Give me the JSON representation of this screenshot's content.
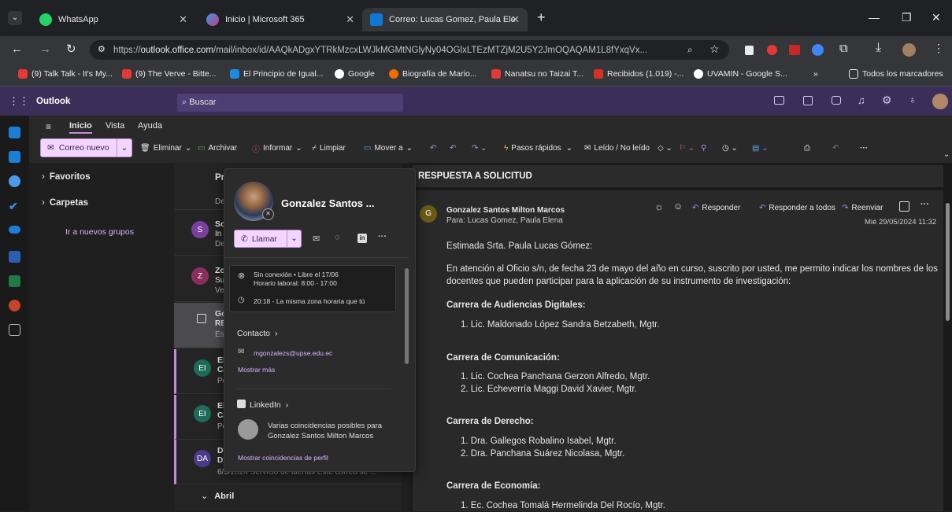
{
  "browser": {
    "tabs": [
      {
        "label": "WhatsApp",
        "active": false
      },
      {
        "label": "Inicio | Microsoft 365",
        "active": false
      },
      {
        "label": "Correo: Lucas Gomez, Paula Ele",
        "active": true
      }
    ],
    "url_prefix": "https://",
    "url_host": "outlook.office.com",
    "url_path": "/mail/inbox/id/AAQkADgxYTRkMzcxLWJkMGMtNGlyNy04OGlxLTEzMTZjM2U5Y2JmOQAQAM1L8fYxqVx...",
    "bookmarks": [
      "(9) Talk Talk - It's My...",
      "(9) The Verve - Bitte...",
      "El Principio de Igual...",
      "Google",
      "Biografía de Mario...",
      "Nanatsu no Taizai T...",
      "Recibidos (1.019) -...",
      "UVAMIN - Google S..."
    ],
    "all_bookmarks": "Todos los marcadores"
  },
  "outlook": {
    "app_name": "Outlook",
    "search_placeholder": "Buscar",
    "ribbon_tabs": [
      "Inicio",
      "Vista",
      "Ayuda"
    ],
    "new_mail": "Correo nuevo",
    "commands": [
      "Eliminar",
      "Archivar",
      "Informar",
      "Limpiar",
      "Mover a",
      "Pasos rápidos",
      "Leído / No leído"
    ],
    "folders": {
      "favorites": "Favoritos",
      "folders": "Carpetas",
      "groups_link": "Ir a nuevos grupos"
    },
    "list_header": "Pr",
    "list_items": [
      {
        "initials": "",
        "line1": "De",
        "line2": "",
        "line3": ""
      },
      {
        "initials": "S",
        "line1": "So",
        "line2": "In",
        "line3": "De"
      },
      {
        "initials": "Z",
        "line1": "Zo",
        "line2": "Su",
        "line3": "Ve"
      },
      {
        "initials": "",
        "line1": "Go",
        "line2": "RE",
        "line3": "Es"
      },
      {
        "initials": "EI",
        "line1": "Els",
        "line2": "Ca",
        "line3": "Po"
      },
      {
        "initials": "EI",
        "line1": "Els",
        "line2": "Ca",
        "line3": "Po"
      },
      {
        "initials": "DA",
        "line1": "Di",
        "line2": "Di",
        "line3": "6/5/2024 Servicio de alertas Este correo se ..."
      }
    ],
    "month_group": "Abril"
  },
  "message": {
    "subject": "RESPUESTA A SOLICITUD",
    "sender_initial": "G",
    "sender": "Gonzalez Santos Milton Marcos",
    "to": "Para: Lucas Gomez, Paula Elena",
    "date": "Mié 29/05/2024 11:32",
    "actions": [
      "Responder",
      "Responder a todos",
      "Reenviar"
    ],
    "greeting": "Estimada Srta. Paula Lucas Gómez:",
    "intro": "En atención al Oficio s/n, de fecha 23 de mayo del año en curso, suscrito por usted, me permito indicar los nombres de los docentes que pueden participar para la aplicación de su instrumento de investigación:",
    "sections": [
      {
        "title": "Carrera de Audiencias Digitales:",
        "items": [
          "1. Lic. Maldonado López Sandra Betzabeth, Mgtr."
        ]
      },
      {
        "title": "Carrera de Comunicación:",
        "items": [
          "1. Lic. Cochea Panchana Gerzon Alfredo, Mgtr.",
          "2. Lic. Echeverría Maggi David Xavier, Mgtr."
        ]
      },
      {
        "title": "Carrera de Derecho:",
        "items": [
          "1. Dra. Gallegos Robalino Isabel, Mgtr.",
          "2. Dra. Panchana Suárez Nicolasa, Mgtr."
        ]
      },
      {
        "title": "Carrera de Economía:",
        "items": [
          "1. Ec. Cochea Tomalá Hermelinda Del Rocío, Mgtr."
        ]
      }
    ]
  },
  "contact_card": {
    "name": "Gonzalez Santos ...",
    "call": "Llamar",
    "status": "Sin conexión • Libre el 17/06",
    "hours": "Horario laboral: 8:00 - 17:00",
    "time": "20:18 - La misma zona horaria que tú",
    "contact_heading": "Contacto",
    "email": "mgonzalezs@upse.edu.ec",
    "show_more": "Mostrar más",
    "linkedin_heading": "LinkedIn",
    "linkedin_text1": "Varias coincidencias posibles para",
    "linkedin_text2": "Gonzalez Santos Milton Marcos",
    "linkedin_more": "Mostrar coincidencias de perfil"
  },
  "colors": {
    "accent": "#c38ad7",
    "header": "#3b2e58"
  }
}
